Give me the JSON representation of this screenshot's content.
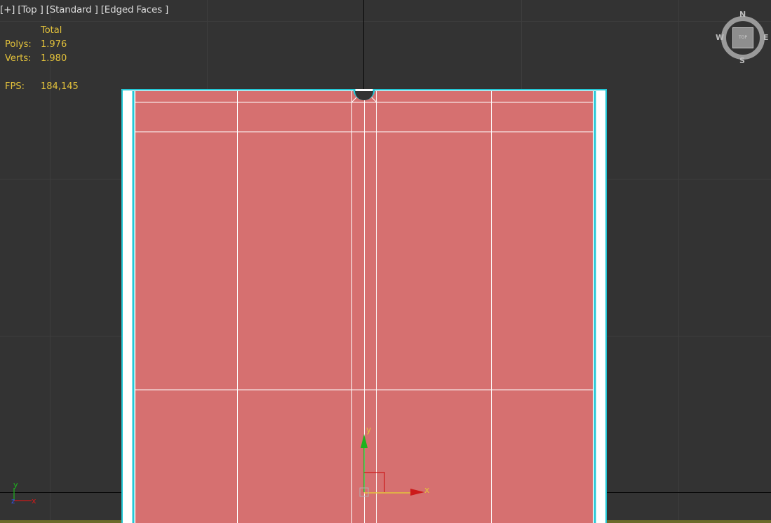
{
  "viewport": {
    "label_items": [
      "[+]",
      "[Top ]",
      "[Standard ]",
      "[Edged Faces ]"
    ]
  },
  "stats": {
    "header": "Total",
    "polys_label": "Polys:",
    "polys_value": "1.976",
    "verts_label": "Verts:",
    "verts_value": "1.980",
    "fps_label": "FPS:",
    "fps_value": "184,145"
  },
  "viewcube": {
    "north": "N",
    "south": "S",
    "east": "E",
    "west": "W",
    "face": "TOP"
  },
  "gizmo": {
    "x_label": "x",
    "y_label": "y"
  },
  "world_axis": {
    "x_label": "x",
    "y_label": "y",
    "z_label": "z"
  },
  "colors": {
    "background": "#333333",
    "mesh_fill": "#d67070",
    "selection_outline": "#23c8d6",
    "stats_text": "#e3c23b",
    "x_axis": "#cc1a1a",
    "y_axis": "#1db31d",
    "z_axis": "#3355ff"
  }
}
